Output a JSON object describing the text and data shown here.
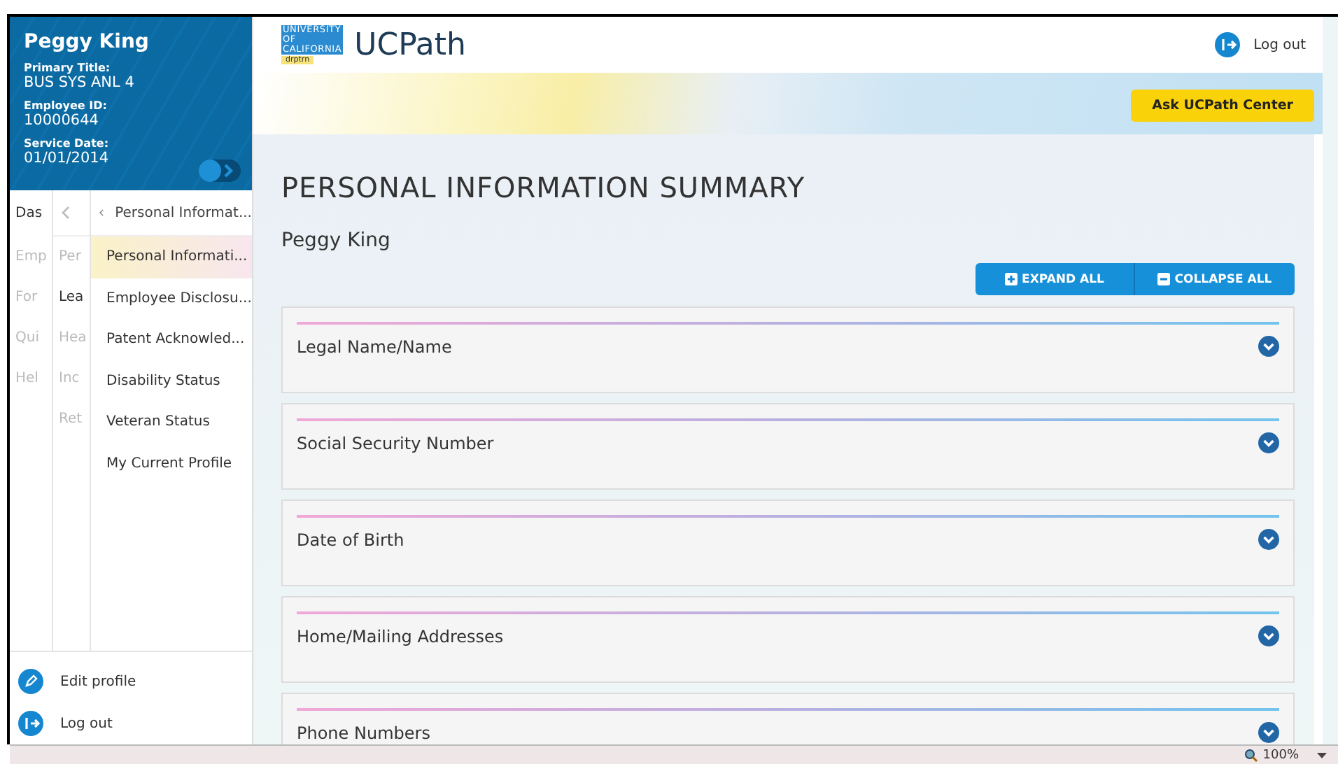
{
  "profile": {
    "name": "Peggy King",
    "fields": [
      {
        "label": "Primary Title:",
        "value": "BUS SYS ANL 4"
      },
      {
        "label": "Employee ID:",
        "value": "10000644"
      },
      {
        "label": "Service Date:",
        "value": "01/01/2014"
      }
    ]
  },
  "menu_level_1": [
    {
      "label": "Das",
      "dimmed": false
    },
    {
      "label": "Emp",
      "dimmed": true
    },
    {
      "label": "For",
      "dimmed": true
    },
    {
      "label": "Qui",
      "dimmed": true
    },
    {
      "label": "Hel",
      "dimmed": true
    }
  ],
  "menu_level_2": [
    {
      "label": "Per",
      "dimmed": true
    },
    {
      "label": "Lea",
      "dimmed": false
    },
    {
      "label": "Hea",
      "dimmed": true
    },
    {
      "label": "Inc",
      "dimmed": true
    },
    {
      "label": "Ret",
      "dimmed": true
    }
  ],
  "menu_level_3": {
    "back_label": "Personal Informat...",
    "items": [
      {
        "label": "Personal Informati...",
        "selected": true
      },
      {
        "label": "Employee Disclosu...",
        "selected": false
      },
      {
        "label": "Patent Acknowled...",
        "selected": false
      },
      {
        "label": "Disability Status",
        "selected": false
      },
      {
        "label": "Veteran Status",
        "selected": false
      },
      {
        "label": "My Current Profile",
        "selected": false
      }
    ]
  },
  "sidebar_footer": [
    "Edit profile",
    "Log out"
  ],
  "header": {
    "logo_lines": [
      "UNIVERSITY",
      "OF",
      "CALIFORNIA"
    ],
    "logo_tag": "drptrn",
    "app_name": "UCPath",
    "logout": "Log out"
  },
  "ask_button": "Ask UCPath Center",
  "page_title": "PERSONAL INFORMATION SUMMARY",
  "person_name": "Peggy King",
  "expand_all": "EXPAND ALL",
  "collapse_all": "COLLAPSE ALL",
  "sections": [
    "Legal Name/Name",
    "Social Security Number",
    "Date of Birth",
    "Home/Mailing Addresses",
    "Phone Numbers"
  ],
  "status_bar": {
    "zoom": "100%"
  }
}
